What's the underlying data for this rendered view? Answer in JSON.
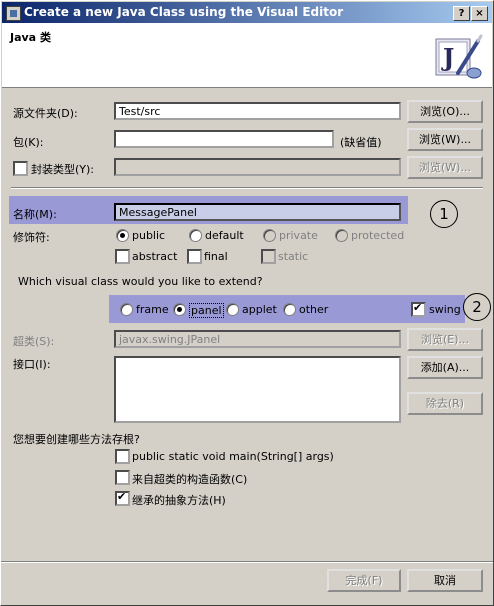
{
  "window": {
    "title": "Create a new Java Class using the Visual Editor",
    "help_btn": "?",
    "close_btn": "×"
  },
  "header": {
    "title": "Java 类"
  },
  "form": {
    "source_folder_label": "源文件夹(D):",
    "source_folder_value": "Test/src",
    "browse1": "浏览(O)...",
    "package_label": "包(K):",
    "package_value": "",
    "package_default": "(缺省值)",
    "browse2": "浏览(W)...",
    "enclosing_label": "封装类型(Y):",
    "enclosing_value": "",
    "browse3": "浏览(W)...",
    "name_label": "名称(M):",
    "name_value": "MessagePanel",
    "modifiers_label": "修饰符:",
    "mod_public": "public",
    "mod_default": "default",
    "mod_private": "private",
    "mod_protected": "protected",
    "mod_abstract": "abstract",
    "mod_final": "final",
    "mod_static": "static",
    "visual_question": "Which visual class would you like to extend?",
    "vc_frame": "frame",
    "vc_panel": "panel",
    "vc_applet": "applet",
    "vc_other": "other",
    "vc_swing": "swing",
    "superclass_label": "超类(S):",
    "superclass_value": "javax.swing.JPanel",
    "browse4": "浏览(E)...",
    "interfaces_label": "接口(I):",
    "add_btn": "添加(A)...",
    "remove_btn": "除去(R)",
    "stubs_question": "您想要创建哪些方法存根?",
    "stub_main": "public static void main(String[] args)",
    "stub_ctor": "来自超类的构造函数(C)",
    "stub_abstract": "继承的抽象方法(H)",
    "finish_btn": "完成(F)",
    "cancel_btn": "取消"
  },
  "annotations": {
    "n1": "1",
    "n2": "2"
  },
  "icons": {
    "header_logo": "java-class-wizard-icon",
    "title_icon": "window-icon"
  }
}
